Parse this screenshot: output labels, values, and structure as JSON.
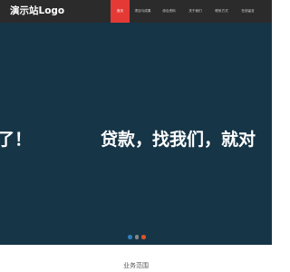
{
  "header": {
    "logo_text": "演示站Logo",
    "nav": [
      {
        "label": "首页",
        "active": true
      },
      {
        "label": "项目与成果"
      },
      {
        "label": "综合资料"
      },
      {
        "label": "关于我们"
      },
      {
        "label": "联系方式"
      },
      {
        "label": "在线留言"
      }
    ]
  },
  "hero": {
    "slide_text_left": "了！",
    "slide_text_right": "贷款，找我们，就对",
    "background_color": "#163547",
    "dots": [
      {
        "color": "#2f7fb8",
        "active": false
      },
      {
        "color": "#888888",
        "active": true
      },
      {
        "color": "#d9542a",
        "active": false
      }
    ]
  },
  "section": {
    "title": "业务范围"
  },
  "colors": {
    "accent": "#e53935",
    "topbar": "#2b2b2b"
  }
}
